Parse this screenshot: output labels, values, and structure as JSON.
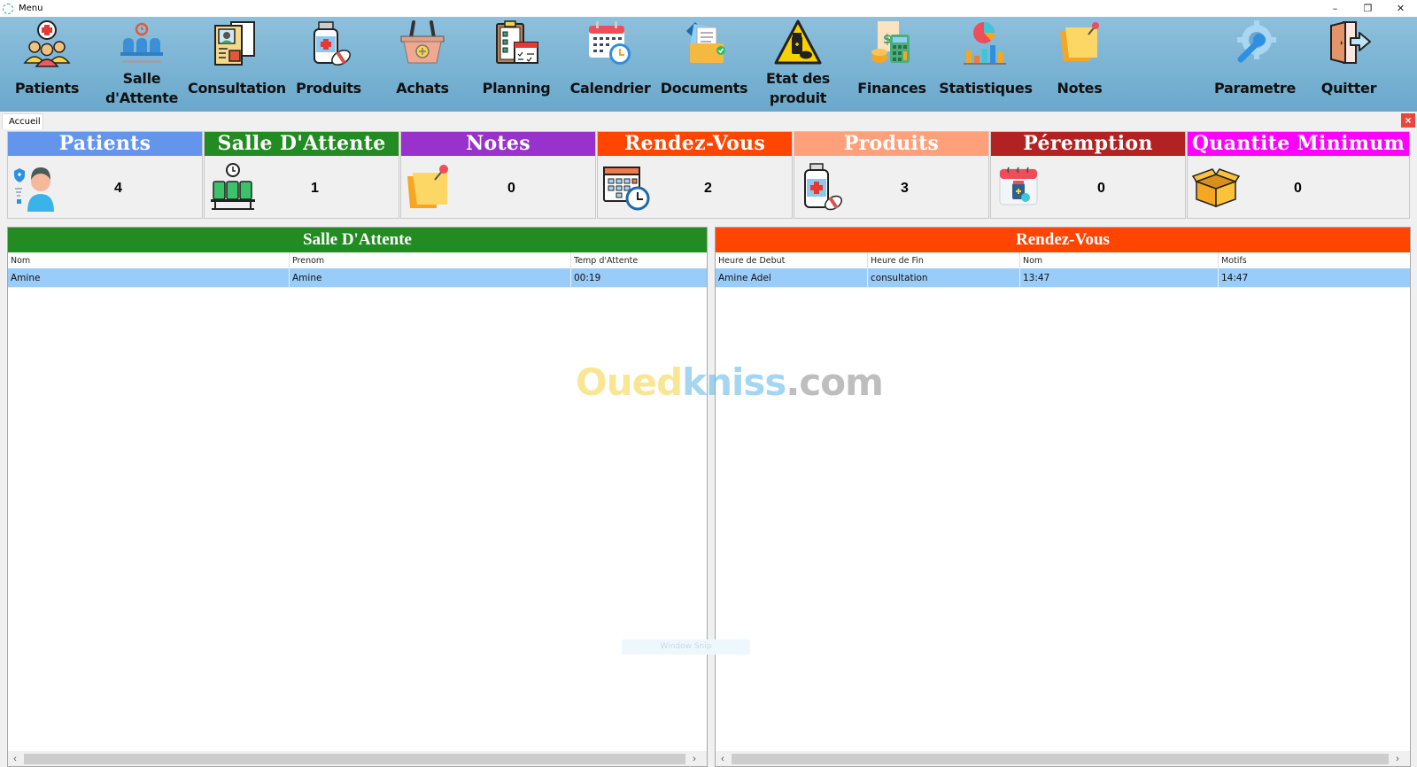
{
  "window": {
    "title": "Menu",
    "controls": [
      "minimize",
      "restore",
      "close"
    ]
  },
  "ribbon": {
    "items": [
      {
        "label": "Patients",
        "icon": "patients-group-icon"
      },
      {
        "label": "Salle d'Attente",
        "icon": "waiting-room-chairs-icon"
      },
      {
        "label": "Consultation",
        "icon": "medical-file-icon"
      },
      {
        "label": "Produits",
        "icon": "medicine-bottle-icon"
      },
      {
        "label": "Achats",
        "icon": "shopping-basket-icon"
      },
      {
        "label": "Planning",
        "icon": "clipboard-planning-icon"
      },
      {
        "label": "Calendrier",
        "icon": "calendar-clock-icon"
      },
      {
        "label": "Documents",
        "icon": "documents-folder-icon"
      },
      {
        "label": "Etat des produit",
        "icon": "warning-medicine-icon"
      },
      {
        "label": "Finances",
        "icon": "calculator-money-icon"
      },
      {
        "label": "Statistiques",
        "icon": "statistics-chart-icon"
      },
      {
        "label": "Notes",
        "icon": "sticky-note-icon"
      },
      {
        "label": "Parametre",
        "icon": "settings-wrench-icon"
      },
      {
        "label": "Quitter",
        "icon": "exit-door-icon"
      }
    ]
  },
  "tabs": {
    "active": "Accueil",
    "close_label": "×"
  },
  "cards": [
    {
      "title": "Patients",
      "value": "4",
      "color": "#6495ed",
      "icon": "patient-avatar-icon"
    },
    {
      "title": "Salle D'Attente",
      "value": "1",
      "color": "#228b22",
      "icon": "waiting-chairs-icon"
    },
    {
      "title": "Notes",
      "value": "0",
      "color": "#9932cc",
      "icon": "sticky-note-icon"
    },
    {
      "title": "Rendez-Vous",
      "value": "2",
      "color": "#ff4500",
      "icon": "calendar-clock-icon"
    },
    {
      "title": "Produits",
      "value": "3",
      "color": "#ffa07a",
      "icon": "medicine-bottle-icon"
    },
    {
      "title": "Péremption",
      "value": "0",
      "color": "#b22222",
      "icon": "expiry-calendar-icon"
    },
    {
      "title": "Quantite Minimum",
      "value": "0",
      "color": "#ff00ff",
      "icon": "open-box-icon"
    }
  ],
  "waiting_panel": {
    "title": "Salle D'Attente",
    "color": "#228b22",
    "columns": [
      "Nom",
      "Prenom",
      "Temp d'Attente"
    ],
    "rows": [
      [
        "Amine",
        "Amine",
        "00:19"
      ]
    ]
  },
  "appointments_panel": {
    "title": "Rendez-Vous",
    "color": "#ff4500",
    "columns": [
      "Heure de Debut",
      "Heure de Fin",
      "Nom",
      "Motifs"
    ],
    "rows": [
      [
        "Amine Adel",
        "consultation",
        "13:47",
        "14:47"
      ]
    ]
  },
  "watermark": {
    "part1": "Oued",
    "part2": "kniss",
    "part3": ".com",
    "snap_label": "Window Snip"
  }
}
